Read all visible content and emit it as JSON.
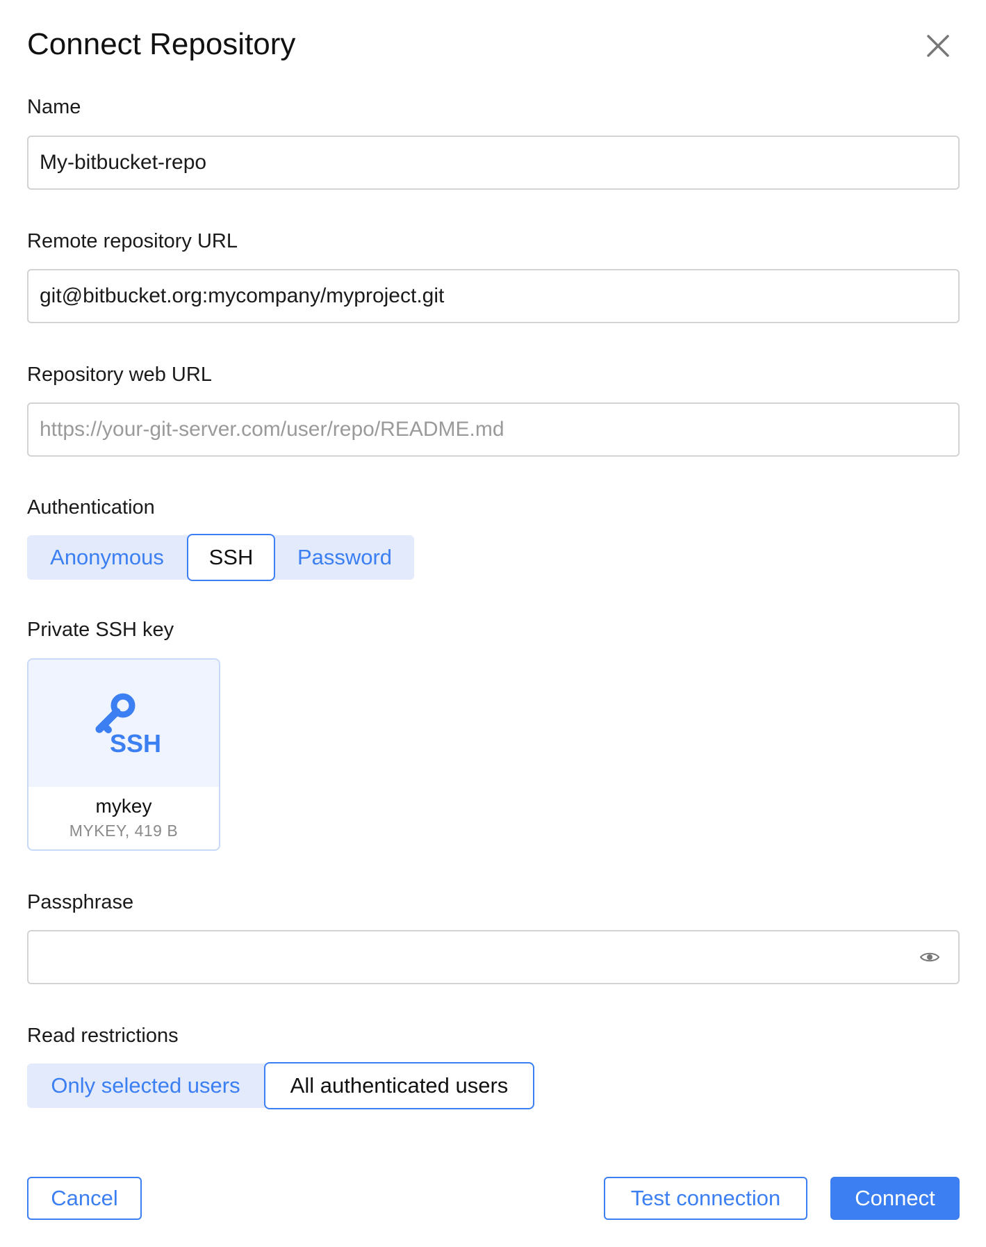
{
  "dialog": {
    "title": "Connect Repository"
  },
  "fields": {
    "name": {
      "label": "Name",
      "value": "My-bitbucket-repo"
    },
    "remote_url": {
      "label": "Remote repository URL",
      "value": "git@bitbucket.org:mycompany/myproject.git"
    },
    "web_url": {
      "label": "Repository web URL",
      "value": "",
      "placeholder": "https://your-git-server.com/user/repo/README.md"
    },
    "authentication": {
      "label": "Authentication",
      "options": [
        "Anonymous",
        "SSH",
        "Password"
      ],
      "selected": "SSH"
    },
    "ssh_key": {
      "label": "Private SSH key",
      "icon_text": "SSH",
      "file_name": "mykey",
      "file_meta": "MYKEY, 419 B"
    },
    "passphrase": {
      "label": "Passphrase",
      "value": ""
    },
    "read_restrictions": {
      "label": "Read restrictions",
      "options": [
        "Only selected users",
        "All authenticated users"
      ],
      "selected": "All authenticated users"
    }
  },
  "footer": {
    "cancel": "Cancel",
    "test": "Test connection",
    "connect": "Connect"
  },
  "colors": {
    "accent": "#3b7ff2",
    "segment_bg": "#e2eafc",
    "card_bg": "#eff4fe"
  }
}
